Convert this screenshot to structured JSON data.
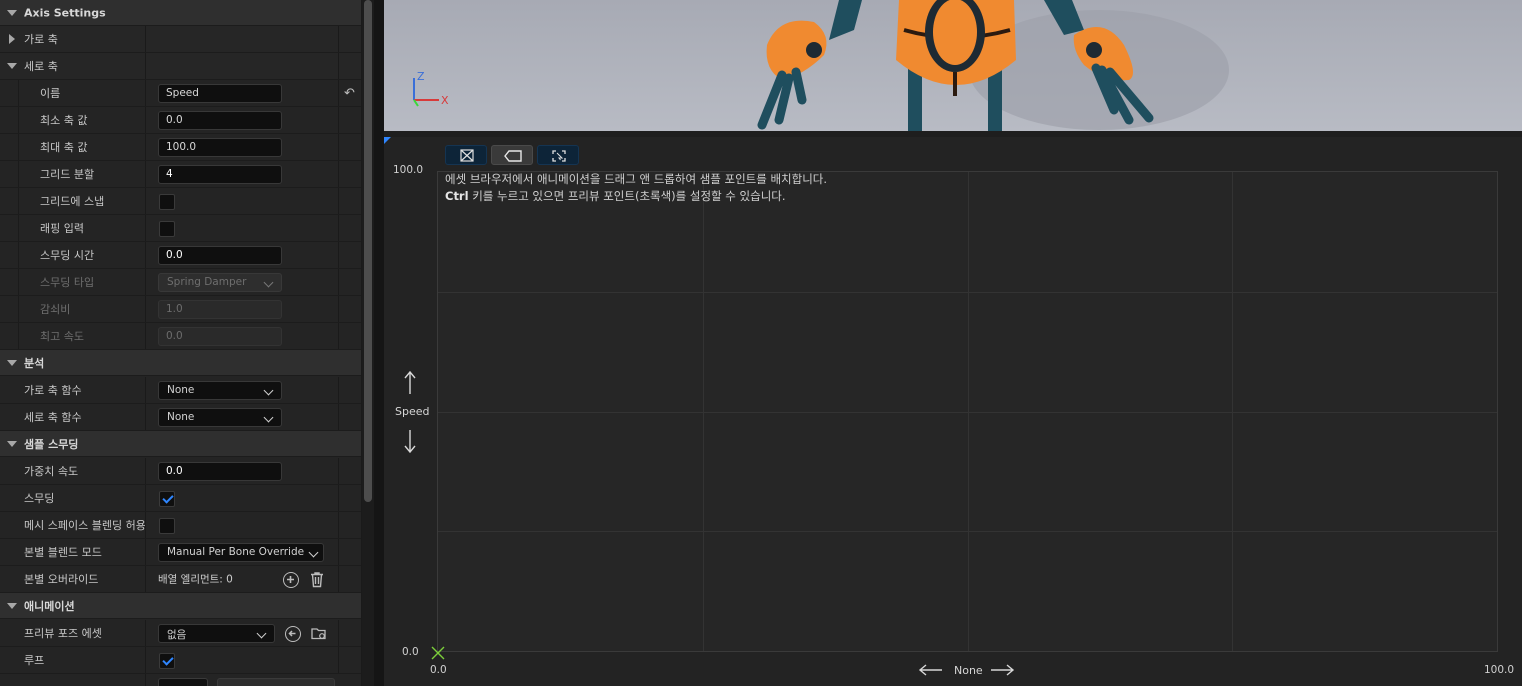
{
  "details": {
    "title": "Axis Settings",
    "horizontal_axis": "가로 축",
    "vertical_axis": "세로 축",
    "fields": {
      "name_label": "이름",
      "name_value": "Speed",
      "min_label": "최소 축 값",
      "min_value": "0.0",
      "max_label": "최대 축 값",
      "max_value": "100.0",
      "grid_label": "그리드 분할",
      "grid_value": "4",
      "snap_label": "그리드에 스냅",
      "wrap_label": "래핑 입력",
      "smooth_time_label": "스무딩 시간",
      "smooth_time_value": "0.0",
      "smooth_type_label": "스무딩 타입",
      "smooth_type_value": "Spring Damper",
      "damping_label": "감쇠비",
      "damping_value": "1.0",
      "max_speed_label": "최고 속도",
      "max_speed_value": "0.0"
    },
    "analysis": {
      "header": "분석",
      "h_func_label": "가로 축 함수",
      "h_func_value": "None",
      "v_func_label": "세로 축 함수",
      "v_func_value": "None"
    },
    "sample_smoothing": {
      "header": "샘플 스무딩",
      "weight_speed_label": "가중치 속도",
      "weight_speed_value": "0.0",
      "smoothing_label": "스무딩",
      "mesh_space_label": "메시 스페이스 블렌딩 허용",
      "per_bone_mode_label": "본별 블렌드 모드",
      "per_bone_mode_value": "Manual Per Bone Override",
      "per_bone_override_label": "본별 오버라이드",
      "per_bone_override_value": "배열 엘리먼트: 0"
    },
    "animation": {
      "header": "애니메이션",
      "preview_pose_label": "프리뷰 포즈 에셋",
      "preview_pose_value": "없음",
      "loop_label": "루프"
    },
    "checks": {
      "snap": false,
      "wrap": false,
      "smoothing": true,
      "mesh_space": false,
      "loop": true
    }
  },
  "viewport": {
    "axis_z": "Z",
    "axis_x": "X"
  },
  "graph": {
    "hint_line1": "에셋 브라우저에서 애니메이션을 드래그 앤 드롭하여 샘플 포인트를 배치합니다.",
    "hint_line2_bold": "Ctrl",
    "hint_line2_rest": " 키를 누르고 있으면 프리뷰 포인트(초록색)를 설정할 수 있습니다.",
    "y_max": "100.0",
    "y_min": "0.0",
    "x_min": "0.0",
    "x_max": "100.0",
    "y_axis_name": "Speed",
    "x_axis_name": "None",
    "grid_divisions": 4
  },
  "colors": {
    "accent_blue": "#2f86ff",
    "preview_green": "#7ccf3a",
    "robot_orange": "#f08a30",
    "robot_teal": "#1f4e5e"
  }
}
